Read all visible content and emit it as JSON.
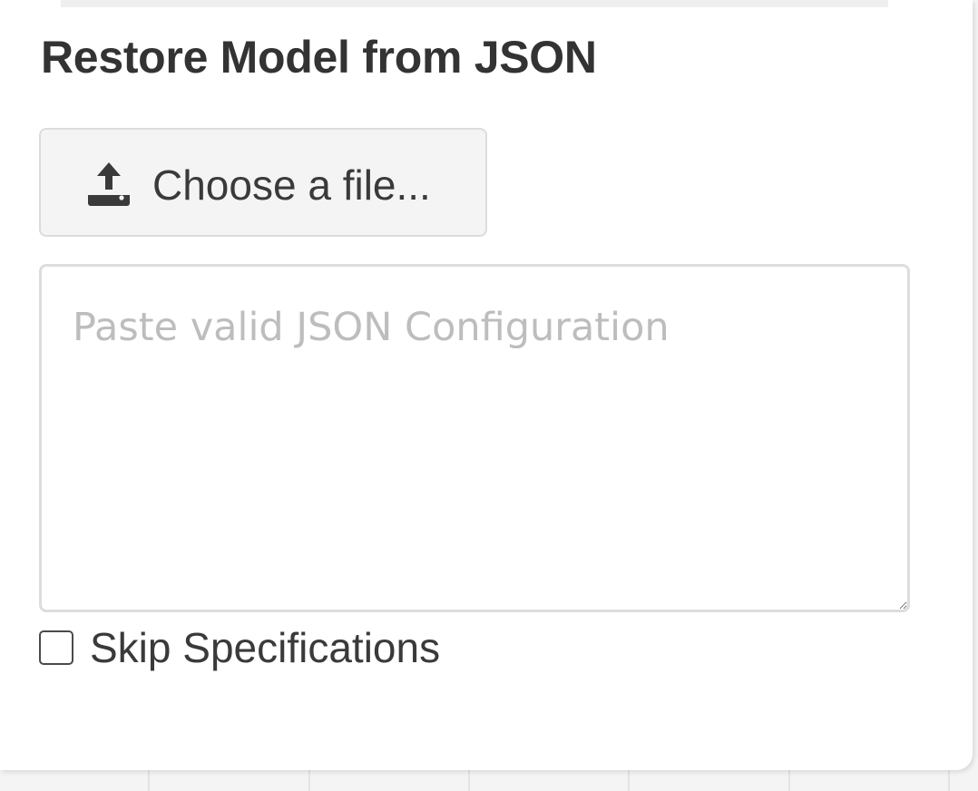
{
  "restore_panel": {
    "title": "Restore Model from JSON",
    "file_button": {
      "label": "Choose a file...",
      "icon": "upload-icon"
    },
    "json_input": {
      "value": "",
      "placeholder": "Paste valid JSON Configuration"
    },
    "skip_specifications": {
      "label": "Skip Specifications",
      "checked": false
    }
  },
  "colors": {
    "title_text": "#333333",
    "button_background": "#f4f4f4",
    "border": "#dddddd",
    "placeholder": "#bdbdbd"
  }
}
